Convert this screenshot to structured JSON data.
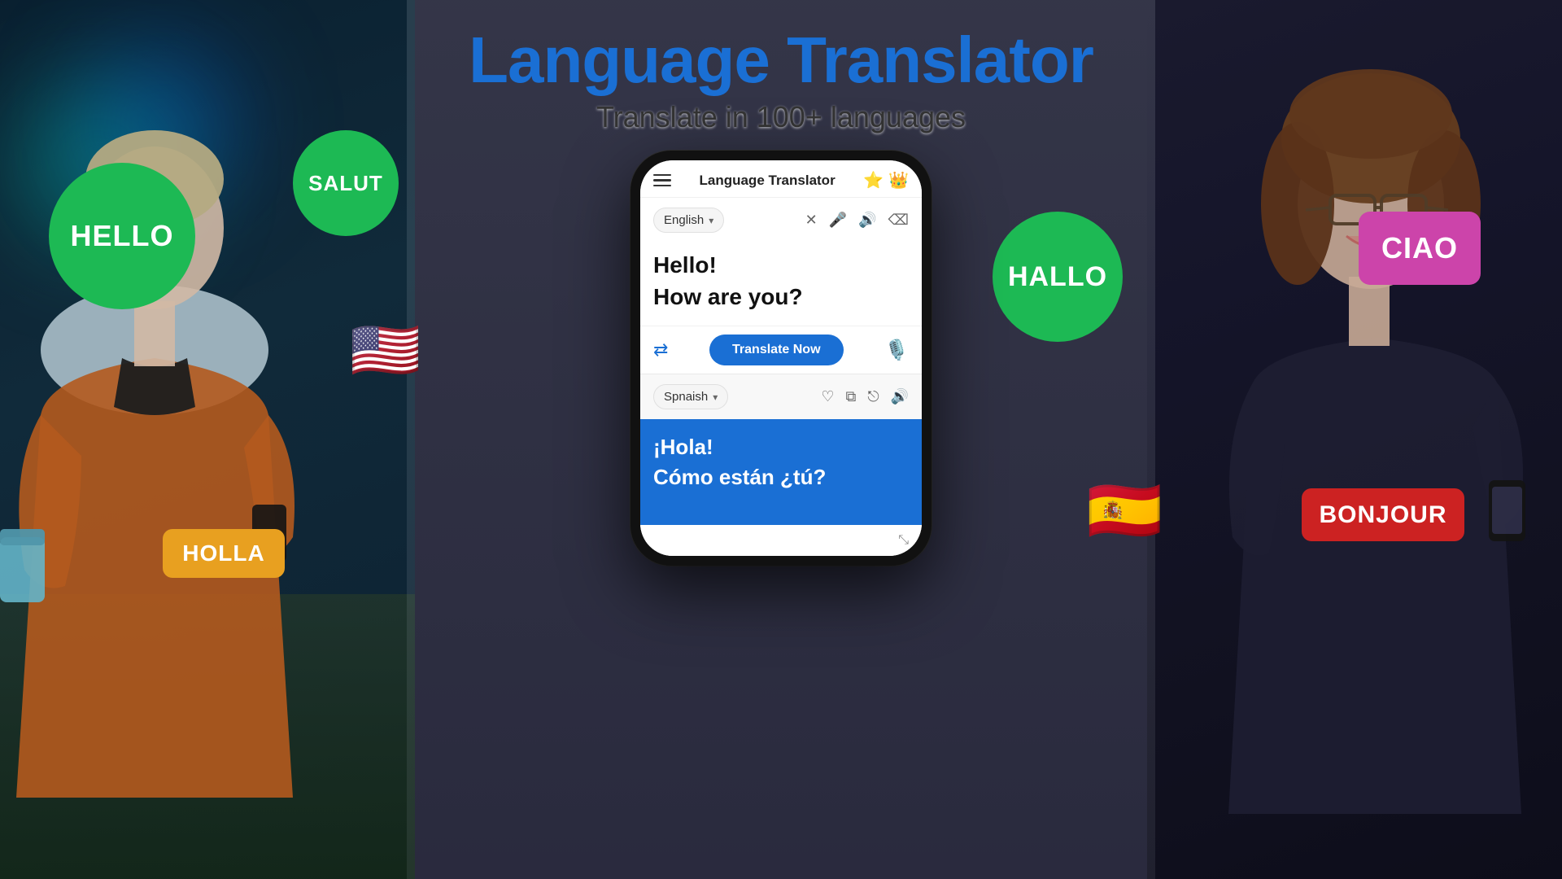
{
  "app": {
    "title": "Language Translator",
    "subtitle": "Translate in 100+ languages"
  },
  "phone": {
    "header": {
      "menu_label": "menu",
      "title": "Language Translator",
      "star_icons": "⭐👑"
    },
    "source": {
      "language": "English",
      "dropdown_arrow": "▾",
      "clear_icon": "✕",
      "mic_icon": "🎤",
      "speaker_icon": "🔊",
      "delete_icon": "⌫",
      "text_line1": "Hello!",
      "text_line2": "How are you?"
    },
    "controls": {
      "swap_icon": "⇄",
      "translate_btn": "Translate Now",
      "mic_icon": "🎙️"
    },
    "target": {
      "language": "Spnaish",
      "dropdown_arrow": "▾",
      "heart_icon": "♡",
      "copy_icon": "⧉",
      "share_icon": "⎋",
      "speaker_icon": "🔊"
    },
    "output": {
      "text_line1": "¡Hola!",
      "text_line2": "Cómo están ¿tú?"
    }
  },
  "bubbles": {
    "hello": "HELLO",
    "salut": "SALUT",
    "holla": "HOLLA",
    "hallo": "HALLO",
    "ciao": "CIAO",
    "bonjour": "BONJOUR"
  },
  "flags": {
    "us": "🇺🇸",
    "es": "🇪🇸"
  },
  "colors": {
    "primary_blue": "#1a6fd4",
    "green_bubble": "#1db954",
    "orange_bubble": "#e8a020",
    "purple_bubble": "#cc44aa",
    "red_bubble": "#cc2222",
    "output_bg": "#1a6fd4"
  }
}
